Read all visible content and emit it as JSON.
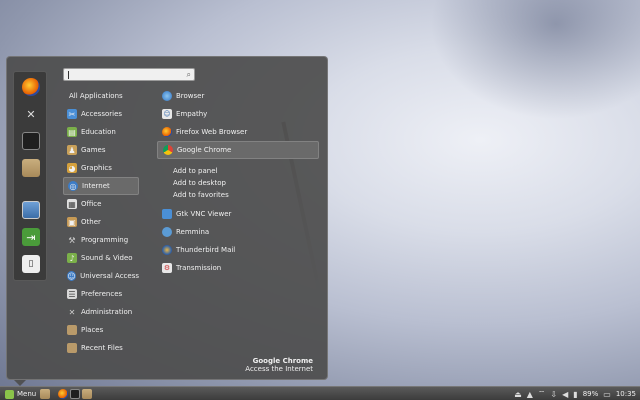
{
  "search": {
    "value": "",
    "icon": "search-icon"
  },
  "favorites": [
    "firefox-icon",
    "tools-icon",
    "terminal-icon",
    "folder-icon",
    "display-icon",
    "logout-icon",
    "lock-icon"
  ],
  "categories": [
    {
      "label": "All Applications",
      "icon": ""
    },
    {
      "label": "Accessories",
      "icon": "accessories-icon"
    },
    {
      "label": "Education",
      "icon": "education-icon"
    },
    {
      "label": "Games",
      "icon": "games-icon"
    },
    {
      "label": "Graphics",
      "icon": "graphics-icon"
    },
    {
      "label": "Internet",
      "icon": "internet-icon",
      "selected": true
    },
    {
      "label": "Office",
      "icon": "office-icon"
    },
    {
      "label": "Other",
      "icon": "other-icon"
    },
    {
      "label": "Programming",
      "icon": "programming-icon"
    },
    {
      "label": "Sound & Video",
      "icon": "sound-video-icon"
    },
    {
      "label": "Universal Access",
      "icon": "universal-access-icon"
    },
    {
      "label": "Preferences",
      "icon": "preferences-icon"
    },
    {
      "label": "Administration",
      "icon": "administration-icon"
    },
    {
      "label": "Places",
      "icon": "places-icon"
    },
    {
      "label": "Recent Files",
      "icon": "recent-files-icon"
    }
  ],
  "apps": [
    {
      "label": "Browser",
      "icon": "browser-icon"
    },
    {
      "label": "Empathy",
      "icon": "empathy-icon"
    },
    {
      "label": "Firefox Web Browser",
      "icon": "firefox-icon"
    },
    {
      "label": "Google Chrome",
      "icon": "chrome-icon",
      "selected": true
    },
    {
      "label": "Gtk VNC Viewer",
      "icon": "vnc-icon"
    },
    {
      "label": "Remmina",
      "icon": "remmina-icon"
    },
    {
      "label": "Thunderbird Mail",
      "icon": "thunderbird-icon"
    },
    {
      "label": "Transmission",
      "icon": "transmission-icon"
    }
  ],
  "app_actions": [
    "Add to panel",
    "Add to desktop",
    "Add to favorites"
  ],
  "info": {
    "name": "Google Chrome",
    "description": "Access the Internet"
  },
  "panel": {
    "menu_label": "Menu",
    "battery": "89%",
    "clock": "10:35"
  }
}
